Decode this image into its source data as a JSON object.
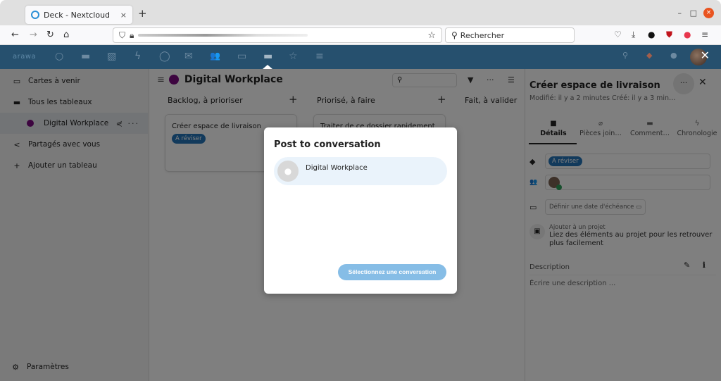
{
  "browser": {
    "tab_title": "Deck - Nextcloud",
    "tab_close": "×",
    "new_tab": "+",
    "window_controls": {
      "minimize": "–",
      "maximize": "□",
      "close": "×"
    },
    "nav": {
      "back": "←",
      "forward": "→",
      "reload": "↻",
      "home": "⌂"
    },
    "url_icons": {
      "shield": "⛉",
      "lock": "🔒",
      "bookmark": "☆"
    },
    "search_placeholder": "Rechercher",
    "search_icon": "⚲",
    "toolbar_icons": [
      "pocket",
      "download",
      "extension",
      "ublock",
      "adblock",
      "menu"
    ],
    "toolbar_glyphs": [
      "♡",
      "⤓",
      "●",
      "⛊",
      "●",
      "≡"
    ]
  },
  "nc_header": {
    "logo": "arawa",
    "apps": [
      {
        "name": "dashboard",
        "glyph": "○"
      },
      {
        "name": "files",
        "glyph": "▬"
      },
      {
        "name": "photos",
        "glyph": "▧"
      },
      {
        "name": "activity",
        "glyph": "ϟ"
      },
      {
        "name": "talk",
        "glyph": "◯"
      },
      {
        "name": "mail",
        "glyph": "✉"
      },
      {
        "name": "contacts",
        "glyph": "👥"
      },
      {
        "name": "calendar",
        "glyph": "▭"
      },
      {
        "name": "deck",
        "glyph": "▬"
      },
      {
        "name": "favorites",
        "glyph": "☆"
      },
      {
        "name": "notes",
        "glyph": "≡"
      }
    ],
    "right": {
      "search": "⚲",
      "notifications": "🔔",
      "contacts": "👤",
      "close": "✕"
    }
  },
  "sidebar": {
    "items": [
      {
        "label": "Cartes à venir",
        "icon": "▭"
      },
      {
        "label": "Tous les tableaux",
        "icon": "▬"
      },
      {
        "label": "Digital Workplace",
        "share": "⋞",
        "more": "···"
      },
      {
        "label": "Partagés avec vous",
        "icon": "<"
      },
      {
        "label": "Ajouter un tableau",
        "icon": "+"
      }
    ],
    "settings": {
      "label": "Paramètres",
      "icon": "⚙"
    }
  },
  "board": {
    "menu_icon": "≡",
    "title": "Digital Workplace",
    "color": "#7b0a80",
    "search_icon": "⚲",
    "tools": {
      "filter": "▼",
      "more": "···",
      "view": "☰"
    },
    "stacks": [
      {
        "title": "Backlog, à prioriser",
        "add": "+",
        "cards": [
          {
            "title": "Créer espace de livraison",
            "label": "A réviser"
          }
        ]
      },
      {
        "title": "Priorisé, à faire",
        "add": "+",
        "cards": [
          {
            "title": "Traiter de ce dossier rapidement :"
          }
        ]
      },
      {
        "title": "Fait, à valider"
      }
    ]
  },
  "details": {
    "title": "Créer espace de livraison",
    "subtitle": "Modifié: il y a 2 minutes Créé: il y a 3 min…",
    "more": "···",
    "close": "✕",
    "tabs": [
      {
        "label": "Détails",
        "icon": "■",
        "active": true
      },
      {
        "label": "Pièces join…",
        "icon": "⌀"
      },
      {
        "label": "Comment…",
        "icon": "▬"
      },
      {
        "label": "Chronologie",
        "icon": "ϟ"
      }
    ],
    "tag_icon": "◆",
    "tag_label": "A réviser",
    "assign_icon": "👥",
    "date_icon": "▭",
    "date_placeholder": "Définir une date d'échéance",
    "date_picker_icon": "▭",
    "project": {
      "icon": "▣",
      "label": "Ajouter à un projet",
      "description": "Liez des éléments au projet pour les retrouver plus facilement"
    },
    "description_label": "Description",
    "description_edit": "✎",
    "description_info": "i",
    "description_placeholder": "Écrire une description ..."
  },
  "modal": {
    "title": "Post to conversation",
    "conversations": [
      {
        "name": "Digital Workplace",
        "avatar": "👥"
      }
    ],
    "button_label": "Sélectionnez une conversation"
  },
  "colors": {
    "header": "#26506e",
    "accent": "#2474b8",
    "board_dot": "#7b0a80",
    "modal_button": "#86bde6"
  }
}
